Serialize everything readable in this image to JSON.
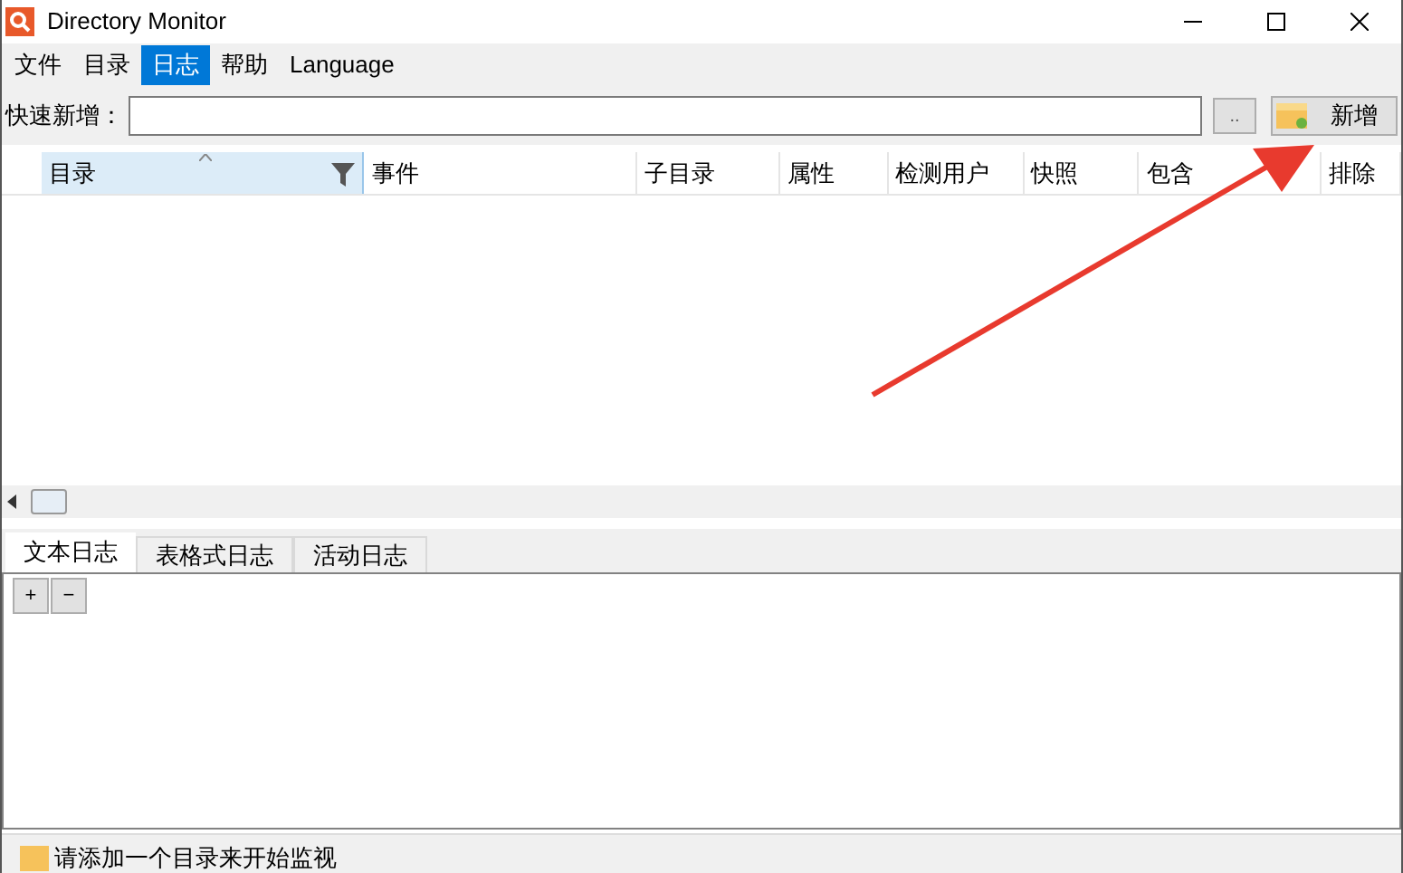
{
  "window": {
    "title": "Directory Monitor"
  },
  "menu": [
    {
      "label": "文件",
      "selected": false
    },
    {
      "label": "目录",
      "selected": false
    },
    {
      "label": "日志",
      "selected": true
    },
    {
      "label": "帮助",
      "selected": false
    },
    {
      "label": "Language",
      "selected": false
    }
  ],
  "quick_add": {
    "label": "快速新增：",
    "browse": "..",
    "add_button": "新增"
  },
  "table": {
    "columns": [
      {
        "label": "目录",
        "sorted": true
      },
      {
        "label": "事件",
        "sorted": false
      },
      {
        "label": "子目录",
        "sorted": false
      },
      {
        "label": "属性",
        "sorted": false
      },
      {
        "label": "检测用户",
        "sorted": false
      },
      {
        "label": "快照",
        "sorted": false
      },
      {
        "label": "包含",
        "sorted": false
      },
      {
        "label": "排除",
        "sorted": false
      }
    ]
  },
  "log_tabs": [
    {
      "label": "文本日志",
      "selected": true
    },
    {
      "label": "表格式日志",
      "selected": false
    },
    {
      "label": "活动日志",
      "selected": false
    }
  ],
  "log_buttons": [
    "+",
    "−"
  ],
  "status_bar": "请添加一个目录来开始监视"
}
